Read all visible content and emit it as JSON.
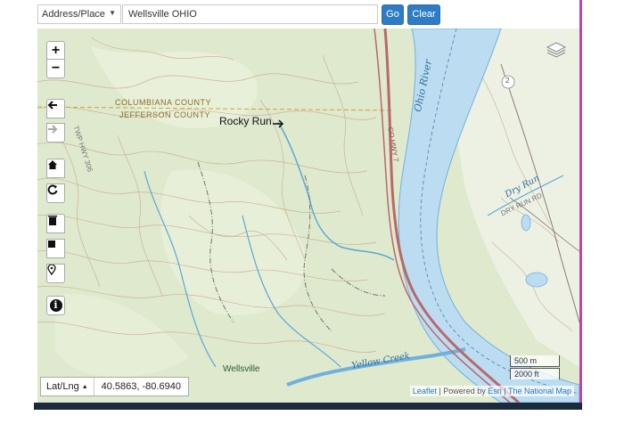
{
  "search": {
    "type_value": "Address/Place",
    "query_value": "Wellsville OHIO",
    "go_label": "Go",
    "clear_label": "Clear"
  },
  "map": {
    "labels": {
      "county_north": "COLUMBIANA COUNTY",
      "county_south": "JEFFERSON COUNTY",
      "rocky_run": "Rocky Run",
      "ohio_river": "Ohio River",
      "dry_run": "Dry Run",
      "dry_run_rd": "DRY RUN RD",
      "co_hwy": "CO HWY 7",
      "twp_hwy": "TWP HWY 306",
      "wellsville": "Wellsville",
      "yellow_creek": "Yellow Creek",
      "route_shield": "2"
    },
    "coordinate_mode": "Lat/Lng",
    "coordinate_value": "40.5863, -80.6940",
    "scale_metric": "500 m",
    "scale_imperial": "2000 ft",
    "attribution": {
      "leaflet": "Leaflet",
      "powered_by": "| Powered by",
      "esri": "Esri",
      "sep": "|",
      "natmap": "The National Map"
    }
  },
  "controls": {
    "zoom_in": "+",
    "zoom_out": "−",
    "back": "🡄",
    "forward": "🡆",
    "info": "i"
  },
  "colors": {
    "terrain": "#dfe9cd",
    "river": "#bcdcf2",
    "water_stroke": "#5aa7d6",
    "highway": "#b9686a",
    "accent_button": "#2f7cc4"
  }
}
